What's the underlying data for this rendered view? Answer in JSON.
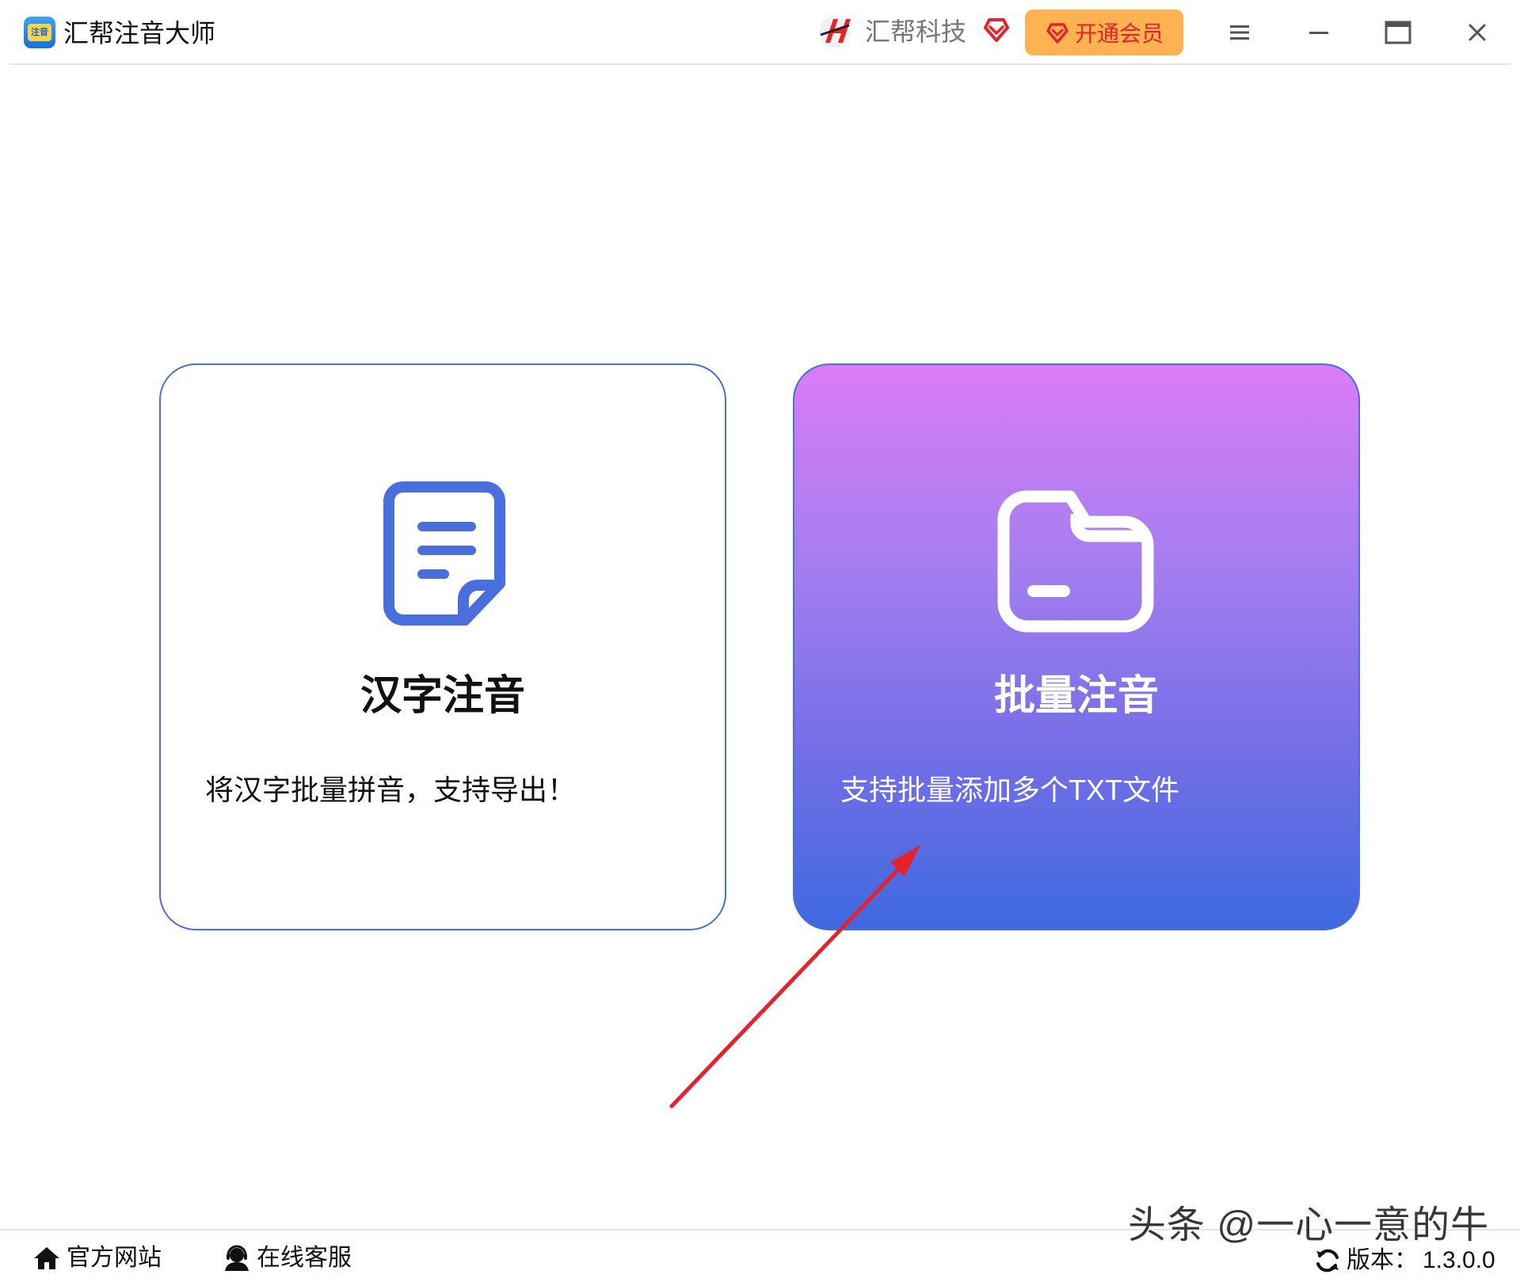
{
  "window": {
    "app_title": "汇帮注音大师",
    "app_logo_text": "注音",
    "brand_name": "汇帮科技",
    "vip_label": "开通会员",
    "icons": [
      "app-logo-icon",
      "brand-logo-icon",
      "diamond-heart-icon",
      "menu-icon",
      "minimize-icon",
      "maximize-icon",
      "close-icon"
    ]
  },
  "cards": [
    {
      "title": "汉字注音",
      "description": "将汉字批量拼音，支持导出！",
      "icon": "document-icon",
      "style": "outlined",
      "accent": "#4a6edb"
    },
    {
      "title": "批量注音",
      "description": "支持批量添加多个TXT文件",
      "icon": "folder-icon",
      "style": "gradient",
      "gradient_colors": [
        "#da7cf6",
        "#3f69df"
      ]
    }
  ],
  "footer": {
    "website_label": "官方网站",
    "support_label": "在线客服",
    "version_label": "版本：",
    "version_value": "1.3.0.0"
  },
  "overlay": {
    "watermark": "头条 @一心一意的牛",
    "arrow_color": "#e8222b"
  },
  "colors": {
    "vip_button": "#fdb352",
    "vip_text": "#e8222b",
    "primary_blue": "#4a6edb"
  }
}
